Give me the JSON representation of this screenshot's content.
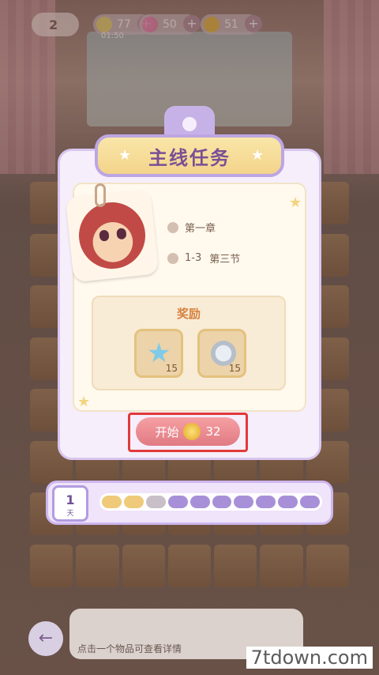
{
  "hud": {
    "level": "2",
    "energy": "77",
    "energy_timer": "01:50",
    "gems": "50",
    "coins": "51"
  },
  "dialog": {
    "title": "主线任务",
    "chapter": "第一章",
    "section_code": "1-3",
    "section_name": "第三节",
    "reward_title": "奖励",
    "rewards": [
      {
        "name": "star-reward",
        "qty": "15"
      },
      {
        "name": "paw-coin-reward",
        "qty": "15"
      }
    ],
    "start_label": "开始",
    "start_cost": "32"
  },
  "progress": {
    "day_num": "1",
    "day_unit": "天",
    "segments_done": 2,
    "segments_total": 10
  },
  "footer": {
    "hint": "点击一个物品可查看详情",
    "watermark": "7tdown.com"
  },
  "colors": {
    "dialog_border": "#d8c6ef",
    "title_text": "#7a4f95",
    "start_button": "#e07a82",
    "highlight_box": "#e03a3a"
  }
}
